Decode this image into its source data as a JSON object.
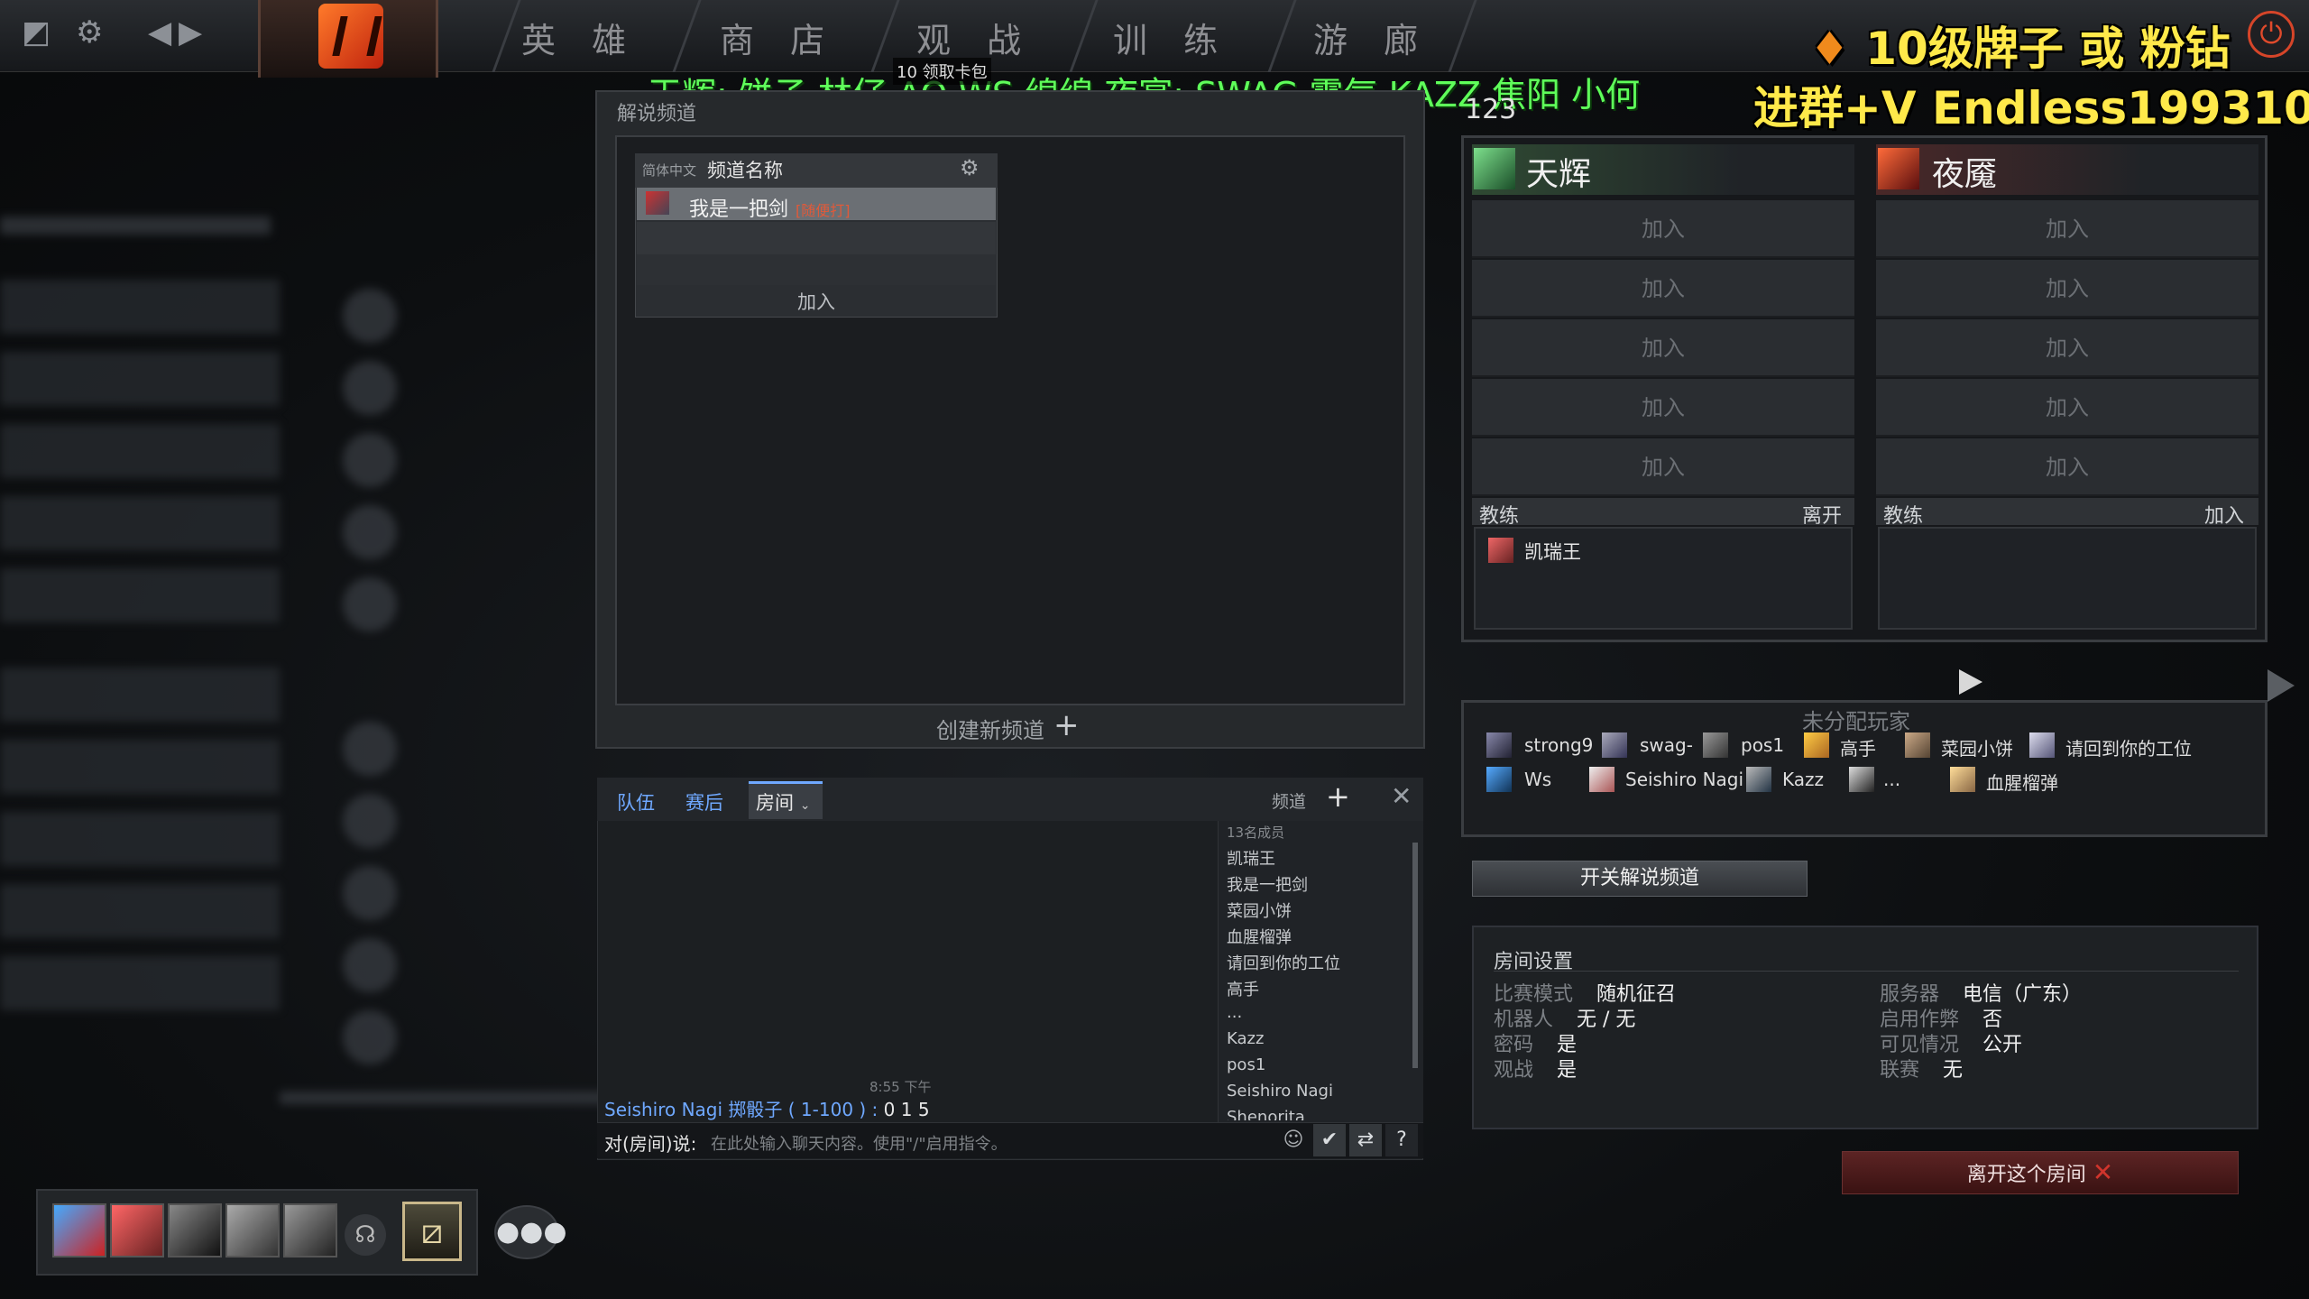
{
  "topbar": {
    "nav": [
      "英 雄",
      "商 店",
      "观 战",
      "训 练",
      "游 廊"
    ]
  },
  "overlays": {
    "promo_line1": "10级牌子 或 粉钻",
    "promo_line2": "进群+V Endless19931026",
    "teams_line": "天辉:  饼子 林仔 AQ WS 绵绵     夜宴:  SWAG 霸气 KAZZ 焦阳 小何",
    "card_badge": "10 领取卡包",
    "number": "123"
  },
  "broadcast": {
    "title": "解说频道",
    "lang": "简体中文",
    "channel_header": "频道名称",
    "channel_row": "我是一把剑",
    "channel_row_tag": "[随便打]",
    "join": "加入",
    "new_channel": "创建新频道"
  },
  "chat": {
    "tabs": [
      "队伍",
      "赛后"
    ],
    "active_tab": "房间",
    "channel_label": "频道",
    "member_count": "13名成员",
    "members": [
      "凯瑞王",
      "我是一把剑",
      "菜园小饼",
      "血腥榴弹",
      "请回到你的工位",
      "高手",
      "...",
      "Kazz",
      "pos1",
      "Seishiro Nagi",
      "Shenorita"
    ],
    "time": "8:55 下午",
    "message": "Seishiro Nagi 掷骰子 ( 1-100 ) :",
    "message_num": "0 1 5",
    "input_prefix": "对(房间)说:",
    "input_placeholder": "在此处输入聊天内容。使用\"/\"启用指令。"
  },
  "teams": {
    "radiant": "天辉",
    "dire": "夜魇",
    "slot_label": "加入",
    "coach": "教练",
    "radiant_coach_action": "离开",
    "dire_coach_action": "加入",
    "radiant_coach_name": "凯瑞王"
  },
  "unassigned": {
    "title": "未分配玩家",
    "players_row1": [
      "strong9",
      "swag-",
      "pos1",
      "高手",
      "菜园小饼",
      "请回到你的工位"
    ],
    "players_row2": [
      "Ws",
      "Seishiro Nagi",
      "Kazz",
      "...",
      "血腥榴弹"
    ]
  },
  "broadcast_toggle": "开关解说频道",
  "settings": {
    "title": "房间设置",
    "left": [
      [
        "比赛模式",
        "随机征召"
      ],
      [
        "机器人",
        "无 / 无"
      ],
      [
        "密码",
        "是"
      ],
      [
        "观战",
        "是"
      ]
    ],
    "right": [
      [
        "服务器",
        "电信（广东）"
      ],
      [
        "启用作弊",
        "否"
      ],
      [
        "可见情况",
        "公开"
      ],
      [
        "联赛",
        "无"
      ]
    ]
  },
  "leave_room": "离开这个房间",
  "colors": {
    "accent_blue": "#6fa8ff",
    "promo_yellow": "#ffe94a",
    "overlay_green": "#5fff5a",
    "leave_red": "#d0342c"
  }
}
